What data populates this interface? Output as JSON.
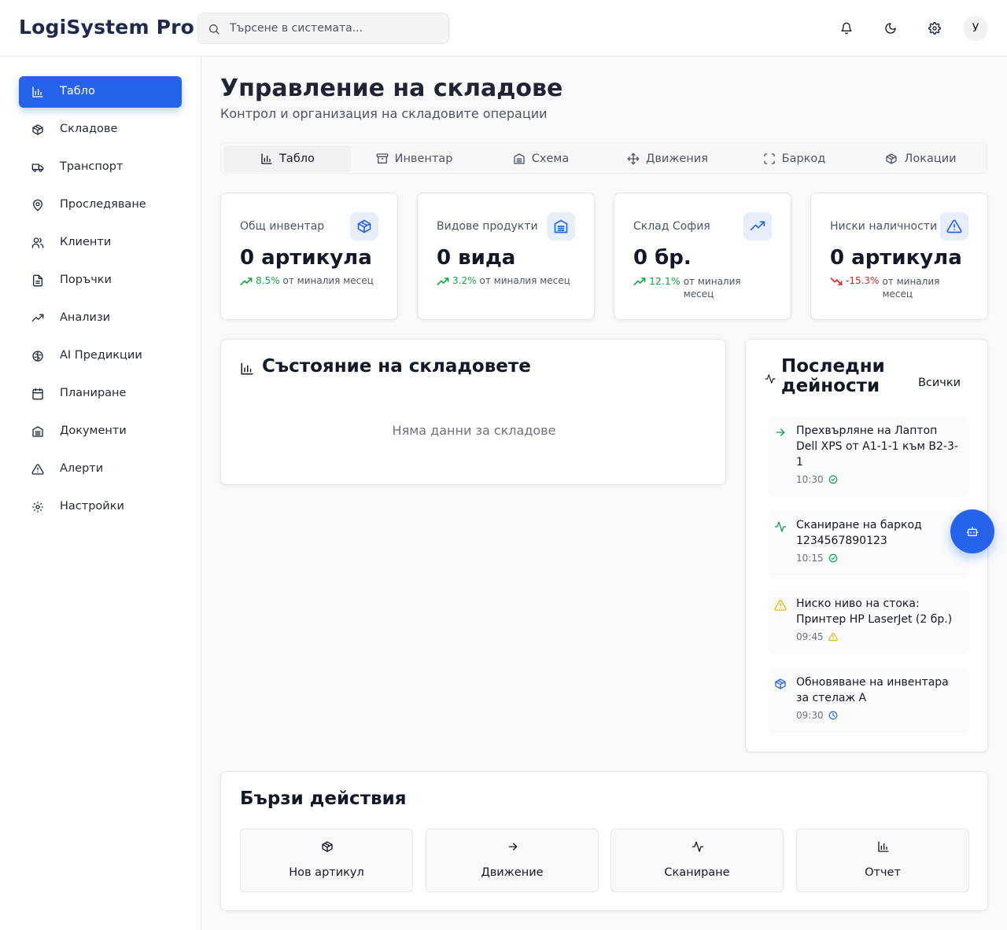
{
  "header": {
    "brand": "LogiSystem Pro",
    "search_placeholder": "Търсене в системата...",
    "avatar_initial": "У"
  },
  "sidebar": {
    "items": [
      {
        "label": "Табло",
        "icon": "bar-chart-icon",
        "active": true
      },
      {
        "label": "Складове",
        "icon": "package-icon"
      },
      {
        "label": "Транспорт",
        "icon": "truck-icon"
      },
      {
        "label": "Проследяване",
        "icon": "map-pin-icon"
      },
      {
        "label": "Клиенти",
        "icon": "users-icon"
      },
      {
        "label": "Поръчки",
        "icon": "file-text-icon"
      },
      {
        "label": "Анализи",
        "icon": "trending-up-icon"
      },
      {
        "label": "AI Предикции",
        "icon": "brain-icon"
      },
      {
        "label": "Планиране",
        "icon": "calendar-icon"
      },
      {
        "label": "Документи",
        "icon": "archive-icon"
      },
      {
        "label": "Алерти",
        "icon": "alert-triangle-icon"
      },
      {
        "label": "Настройки",
        "icon": "gear-icon"
      }
    ]
  },
  "main": {
    "title": "Управление на складове",
    "subtitle": "Контрол и организация на складовите операции",
    "tabs": [
      {
        "label": "Табло",
        "icon": "bar-chart-icon",
        "active": true
      },
      {
        "label": "Инвентар",
        "icon": "archive-box-icon"
      },
      {
        "label": "Схема",
        "icon": "warehouse-icon"
      },
      {
        "label": "Движения",
        "icon": "move-icon"
      },
      {
        "label": "Баркод",
        "icon": "scan-icon"
      },
      {
        "label": "Локации",
        "icon": "package-icon"
      }
    ],
    "stats": [
      {
        "label": "Общ инвентар",
        "value": "0 артикула",
        "pct": "8.5%",
        "suffix": "от миналия месец",
        "direction": "up",
        "icon": "package-icon"
      },
      {
        "label": "Видове продукти",
        "value": "0 вида",
        "pct": "3.2%",
        "suffix": "от миналия месец",
        "direction": "up",
        "icon": "warehouse-icon"
      },
      {
        "label": "Склад София",
        "value": "0 бр.",
        "pct": "12.1%",
        "suffix": "от миналия месец",
        "direction": "up",
        "icon": "trending-up-icon"
      },
      {
        "label": "Ниски наличности",
        "value": "0 артикула",
        "pct": "-15.3%",
        "suffix": "от миналия месец",
        "direction": "down",
        "icon": "alert-triangle-icon"
      }
    ],
    "warehouse_state": {
      "title": "Състояние на складовете",
      "empty": "Няма данни за складове"
    },
    "activity": {
      "title": "Последни дейности",
      "all_button": "Всички",
      "items": [
        {
          "text": "Прехвърляне на Лаптоп Dell XPS от A1-1-1 към B2-3-1",
          "time": "10:30",
          "icon": "arrow-right-icon",
          "status_icon": "check-circle-icon",
          "color": "#16a34a"
        },
        {
          "text": "Сканиране на баркод 1234567890123",
          "time": "10:15",
          "icon": "activity-icon",
          "status_icon": "check-circle-icon",
          "color": "#16a34a"
        },
        {
          "text": "Ниско ниво на стока: Принтер HP LaserJet (2 бр.)",
          "time": "09:45",
          "icon": "alert-triangle-icon",
          "status_icon": "alert-triangle-icon",
          "color": "#eab308"
        },
        {
          "text": "Обновяване на инвентара за стелаж A",
          "time": "09:30",
          "icon": "package-icon",
          "status_icon": "clock-icon",
          "color": "#2563eb"
        }
      ]
    },
    "quick_actions": {
      "title": "Бързи действия",
      "items": [
        {
          "label": "Нов артикул",
          "icon": "package-icon"
        },
        {
          "label": "Движение",
          "icon": "arrow-right-icon"
        },
        {
          "label": "Сканиране",
          "icon": "activity-icon"
        },
        {
          "label": "Отчет",
          "icon": "bar-chart-icon"
        }
      ]
    }
  },
  "colors": {
    "accent": "#2563eb",
    "positive": "#16a34a",
    "negative": "#dc2626",
    "warning": "#eab308",
    "brand_text": "#1e2a4a"
  }
}
